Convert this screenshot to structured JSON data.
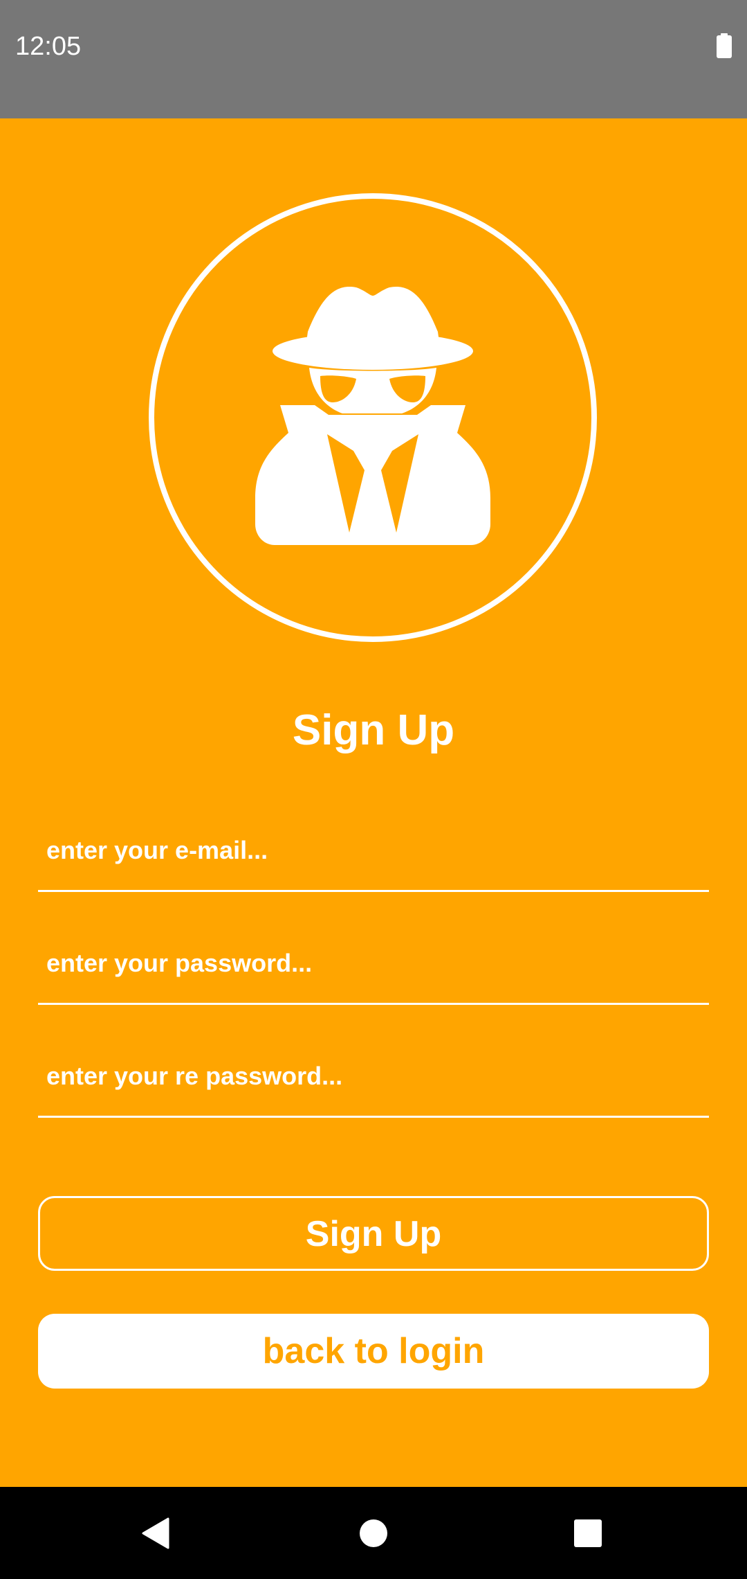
{
  "status_bar": {
    "time": "12:05",
    "battery_icon": "battery-full-icon",
    "background": "#777777"
  },
  "theme": {
    "accent": "#FFA500",
    "foreground": "#FFFFFF",
    "nav_background": "#000000"
  },
  "avatar": {
    "icon": "spy-incognito-icon"
  },
  "form": {
    "title": "Sign Up",
    "email": {
      "value": "",
      "placeholder": "enter your e-mail..."
    },
    "password": {
      "value": "",
      "placeholder": "enter your password..."
    },
    "re_password": {
      "value": "",
      "placeholder": "enter your re password..."
    },
    "signup_label": "Sign Up",
    "back_label": "back to login"
  },
  "nav_bar": {
    "back_icon": "back-triangle-icon",
    "home_icon": "home-circle-icon",
    "recents_icon": "recents-square-icon"
  }
}
